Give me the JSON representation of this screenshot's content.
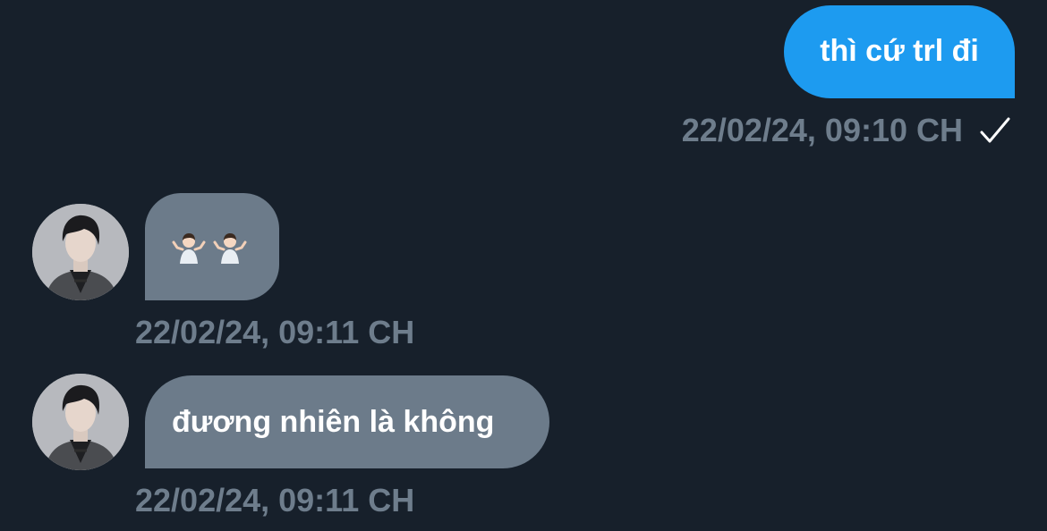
{
  "conversation": {
    "messages": [
      {
        "direction": "outgoing",
        "text": "thì cứ trl đi",
        "timestamp": "22/02/24, 09:10 CH",
        "status_icon": "checkmark-icon"
      },
      {
        "direction": "incoming",
        "content_icons": [
          "person-shrugging-emoji",
          "person-shrugging-emoji"
        ],
        "timestamp": "22/02/24, 09:11 CH",
        "avatar_icon": "contact-avatar"
      },
      {
        "direction": "incoming",
        "text": "đương nhiên là không",
        "timestamp": "22/02/24, 09:11 CH",
        "avatar_icon": "contact-avatar"
      }
    ]
  },
  "colors": {
    "background": "#17202b",
    "outgoing_bubble": "#1d9bf0",
    "incoming_bubble": "#6c7b8a",
    "timestamp": "#6e7d8c",
    "text": "#ffffff"
  }
}
